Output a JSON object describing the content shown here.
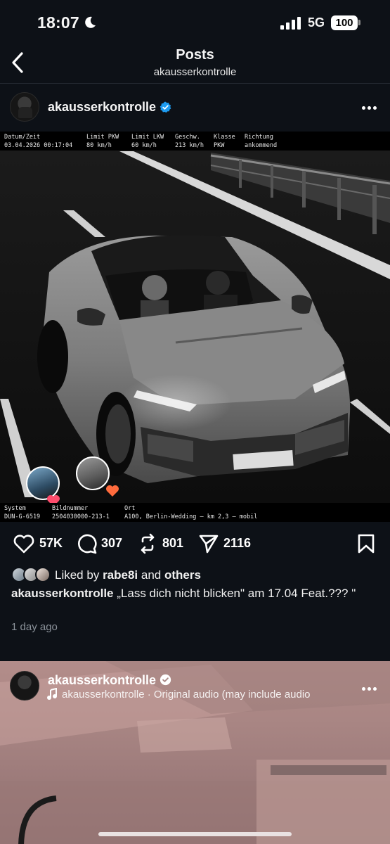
{
  "status_bar": {
    "time": "18:07",
    "network": "5G",
    "battery": "100"
  },
  "header": {
    "title": "Posts",
    "subtitle": "akausserkontrolle"
  },
  "post": {
    "username": "akausserkontrolle",
    "radar_top": {
      "labels": [
        "Datum/Zeit",
        "Limit PKW",
        "Limit LKW",
        "Geschw.",
        "Klasse",
        "Richtung"
      ],
      "values": [
        "03.04.2026 00:17:04",
        "80 km/h",
        "60 km/h",
        "213 km/h",
        "PKW",
        "ankommend"
      ]
    },
    "radar_bottom": {
      "labels": [
        "System",
        "Bildnummer",
        "Ort"
      ],
      "values": [
        "DUN-G-6519",
        "2504030000-213-1",
        "A100, Berlin-Wedding — km 2,3 — mobil"
      ]
    },
    "likes_count": "57K",
    "comments_count": "307",
    "reposts_count": "801",
    "shares_count": "2116",
    "liked_by": {
      "prefix": "Liked by",
      "user": "rabe8i",
      "middle": "and",
      "suffix": "others"
    },
    "caption_text": "„Lass dich nicht blicken\" am 17.04 Feat.??? \"",
    "timestamp": "1 day ago"
  },
  "next_post": {
    "username": "akausserkontrolle",
    "audio": "akausserkontrolle · Original audio  (may include audio"
  },
  "colors": {
    "background": "#0d1117",
    "verified": "#1d9bf0",
    "heart_badge": "#ff4d6d"
  },
  "icons": [
    "chevron-left-icon",
    "verified-badge-icon",
    "more-dots-icon",
    "heart-icon",
    "comment-bubble-icon",
    "repost-icon",
    "send-icon",
    "bookmark-icon",
    "music-note-icon"
  ]
}
